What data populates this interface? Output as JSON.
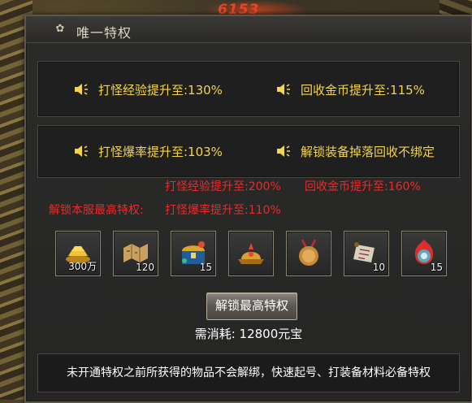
{
  "background": {
    "fire_text": "6153"
  },
  "window": {
    "title": "唯一特权",
    "title_icon": "swirl-icon"
  },
  "perks_row1": {
    "left": "打怪经验提升至:130%",
    "right": "回收金币提升至:115%"
  },
  "perks_row2": {
    "left": "打怪爆率提升至:103%",
    "right": "解锁装备掉落回收不绑定"
  },
  "top_privilege": {
    "label": "解锁本服最高特权:",
    "exp": "打怪经验提升至:200%",
    "gold": "回收金币提升至:160%",
    "drop": "打怪爆率提升至:110%"
  },
  "rewards": [
    {
      "icon": "gold-ingots-icon",
      "count": "300万"
    },
    {
      "icon": "treasure-map-icon",
      "count": "120"
    },
    {
      "icon": "treasure-chest-icon",
      "count": "15"
    },
    {
      "icon": "golden-helmet-icon",
      "count": ""
    },
    {
      "icon": "medal-coin-icon",
      "count": ""
    },
    {
      "icon": "scroll-icon",
      "count": "10"
    },
    {
      "icon": "fire-orb-icon",
      "count": "15"
    }
  ],
  "unlock_button": "解锁最高特权",
  "cost": "需消耗:  12800元宝",
  "note": "未开通特权之前所获得的物品不会解绑，快速起号、打装备材料必备特权",
  "colors": {
    "perk_text": "#f3d44a",
    "privilege_text": "#e82b2b"
  }
}
